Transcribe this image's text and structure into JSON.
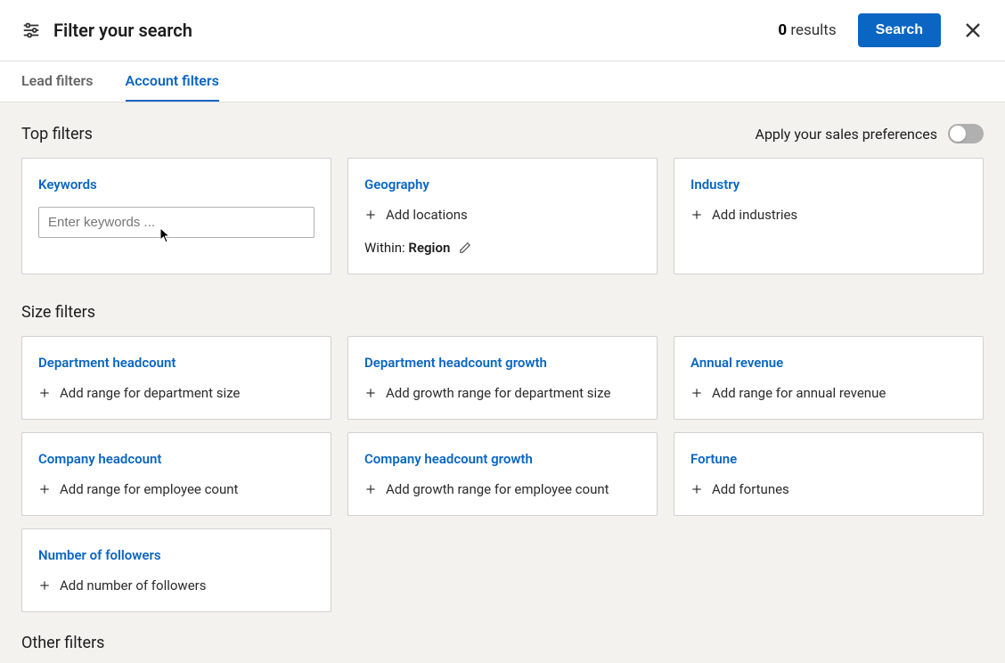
{
  "header": {
    "title": "Filter your search",
    "results_count": "0",
    "results_label": "results",
    "search_button": "Search"
  },
  "tabs": {
    "lead": "Lead filters",
    "account": "Account filters"
  },
  "sections": {
    "top_filters": "Top filters",
    "size_filters": "Size filters",
    "other_filters": "Other filters"
  },
  "sales_pref": {
    "label": "Apply your sales preferences"
  },
  "keywords": {
    "title": "Keywords",
    "placeholder": "Enter keywords ..."
  },
  "geography": {
    "title": "Geography",
    "add_label": "Add locations",
    "within_prefix": "Within: ",
    "within_value": "Region"
  },
  "industry": {
    "title": "Industry",
    "add_label": "Add industries"
  },
  "dept_headcount": {
    "title": "Department headcount",
    "add_label": "Add range for department size"
  },
  "dept_growth": {
    "title": "Department headcount growth",
    "add_label": "Add growth range for department size"
  },
  "annual_revenue": {
    "title": "Annual revenue",
    "add_label": "Add range for annual revenue"
  },
  "company_headcount": {
    "title": "Company headcount",
    "add_label": "Add range for employee count"
  },
  "company_growth": {
    "title": "Company headcount growth",
    "add_label": "Add growth range for employee count"
  },
  "fortune": {
    "title": "Fortune",
    "add_label": "Add fortunes"
  },
  "followers": {
    "title": "Number of followers",
    "add_label": "Add number of followers"
  }
}
